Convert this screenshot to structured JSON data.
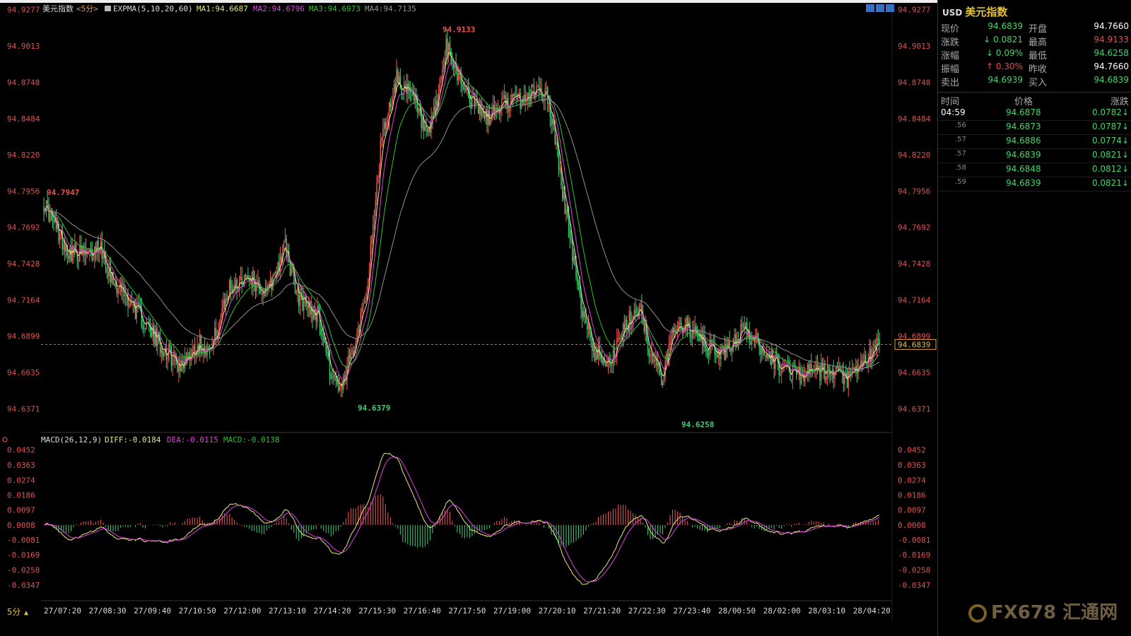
{
  "main": {
    "indicator_name": "美元指数",
    "period": "<5分>",
    "expma_label": "EXPMA(5,10,20,60)",
    "ma1": "MA1:94.6687",
    "ma2": "MA2:94.6796",
    "ma3": "MA3:94.6973",
    "ma4": "MA4:94.7135",
    "y_ticks": [
      "94.9277",
      "94.9013",
      "94.8748",
      "94.8484",
      "94.8220",
      "94.7956",
      "94.7692",
      "94.7428",
      "94.7164",
      "94.6899",
      "94.6635",
      "94.6371"
    ],
    "high_label": "94.9133",
    "low_label_1": "94.6379",
    "low_label_2": "94.6258",
    "left_high_label": "94.7947",
    "current_price_tag": "94.6839",
    "ylim": [
      94.6208,
      94.9327
    ]
  },
  "macd": {
    "label": "MACD(26,12,9)",
    "diff": "DIFF:-0.0184",
    "dea": "DEA:-0.0115",
    "macd": "MACD:-0.0138",
    "y_ticks": [
      "0.0452",
      "0.0363",
      "0.0274",
      "0.0186",
      "0.0097",
      "0.0008",
      "-0.0081",
      "-0.0169",
      "-0.0258",
      "-0.0347"
    ],
    "ylim": [
      -0.044,
      0.048
    ]
  },
  "x_ticks": [
    "27/07:20",
    "27/08:30",
    "27/09:40",
    "27/10:50",
    "27/12:00",
    "27/13:10",
    "27/14:20",
    "27/15:30",
    "27/16:40",
    "27/17:50",
    "27/19:00",
    "27/20:10",
    "27/21:20",
    "27/22:30",
    "27/23:40",
    "28/00:50",
    "28/02:00",
    "28/03:10",
    "28/04:20"
  ],
  "period_button": "5分",
  "colors": {
    "up": "#f05a5a",
    "down": "#3fd07a",
    "ma1": "#e8e880",
    "ma2": "#e040e0",
    "ma3": "#30c030",
    "ma4": "#909090"
  },
  "chart_data": {
    "type": "candlestick",
    "waypoints": [
      [
        0,
        94.788
      ],
      [
        10,
        94.768
      ],
      [
        20,
        94.752
      ],
      [
        38,
        94.748
      ],
      [
        45,
        94.758
      ],
      [
        55,
        94.732
      ],
      [
        70,
        94.715
      ],
      [
        90,
        94.688
      ],
      [
        110,
        94.668
      ],
      [
        125,
        94.685
      ],
      [
        135,
        94.68
      ],
      [
        150,
        94.725
      ],
      [
        165,
        94.735
      ],
      [
        180,
        94.72
      ],
      [
        195,
        94.756
      ],
      [
        205,
        94.718
      ],
      [
        222,
        94.705
      ],
      [
        232,
        94.663
      ],
      [
        240,
        94.648
      ],
      [
        252,
        94.69
      ],
      [
        262,
        94.73
      ],
      [
        272,
        94.83
      ],
      [
        285,
        94.878
      ],
      [
        300,
        94.86
      ],
      [
        310,
        94.832
      ],
      [
        318,
        94.862
      ],
      [
        325,
        94.9
      ],
      [
        335,
        94.88
      ],
      [
        345,
        94.862
      ],
      [
        358,
        94.848
      ],
      [
        372,
        94.86
      ],
      [
        388,
        94.862
      ],
      [
        398,
        94.87
      ],
      [
        406,
        94.866
      ],
      [
        412,
        94.84
      ],
      [
        420,
        94.79
      ],
      [
        432,
        94.72
      ],
      [
        445,
        94.678
      ],
      [
        458,
        94.672
      ],
      [
        472,
        94.7
      ],
      [
        482,
        94.713
      ],
      [
        490,
        94.676
      ],
      [
        500,
        94.658
      ],
      [
        510,
        94.7
      ],
      [
        520,
        94.697
      ],
      [
        535,
        94.682
      ],
      [
        550,
        94.677
      ],
      [
        565,
        94.695
      ],
      [
        580,
        94.682
      ],
      [
        595,
        94.667
      ],
      [
        610,
        94.662
      ],
      [
        625,
        94.664
      ],
      [
        638,
        94.662
      ],
      [
        650,
        94.658
      ],
      [
        660,
        94.668
      ],
      [
        675,
        94.684
      ]
    ],
    "extremes": {
      "high": 94.9133,
      "low_1": 94.6379,
      "low_2": 94.6258,
      "left_high": 94.7947,
      "last": 94.6839
    },
    "ylim": [
      94.6208,
      94.9327
    ],
    "macd_ylim": [
      -0.044,
      0.048
    ]
  },
  "panel": {
    "code": "USD",
    "name": "美元指数",
    "quote": [
      {
        "l1": "现价",
        "v1": "94.6839",
        "c1": "green",
        "l2": "开盘",
        "v2": "94.7660",
        "c2": "white"
      },
      {
        "l1": "涨跌",
        "v1": "↓ 0.0821",
        "c1": "green",
        "l2": "最高",
        "v2": "94.9133",
        "c2": "red"
      },
      {
        "l1": "涨幅",
        "v1": "↓ 0.09%",
        "c1": "green",
        "l2": "最低",
        "v2": "94.6258",
        "c2": "green"
      },
      {
        "l1": "振幅",
        "v1": "↑ 0.30%",
        "c1": "red",
        "l2": "昨收",
        "v2": "94.7660",
        "c2": "white"
      },
      {
        "l1": "卖出",
        "v1": "94.6939",
        "c1": "green",
        "l2": "买入",
        "v2": "94.6839",
        "c2": "green"
      }
    ],
    "headers": [
      "时间",
      "价格",
      "涨跌"
    ],
    "ticks": [
      {
        "time": "04:59",
        "price": "94.6878",
        "chg": "0.0782↓"
      },
      {
        "time": ".56",
        "price": "94.6873",
        "chg": "0.0787↓"
      },
      {
        "time": ".57",
        "price": "94.6886",
        "chg": "0.0774↓"
      },
      {
        "time": ".57",
        "price": "94.6839",
        "chg": "0.0821↓"
      },
      {
        "time": ".58",
        "price": "94.6848",
        "chg": "0.0812↓"
      },
      {
        "time": ".59",
        "price": "94.6839",
        "chg": "0.0821↓"
      }
    ]
  },
  "logo": {
    "text": "FX678 汇通网"
  }
}
